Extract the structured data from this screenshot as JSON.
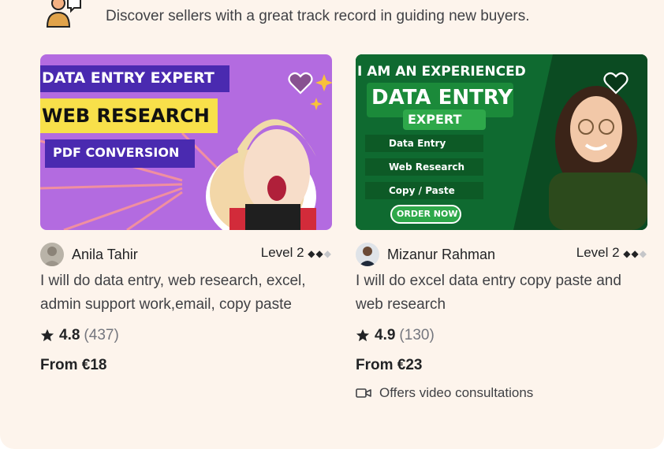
{
  "header": {
    "subtitle": "Discover sellers with a great track record in guiding new buyers."
  },
  "gigs": [
    {
      "image_text": {
        "line1": "DATA ENTRY EXPERT",
        "line2": "WEB RESEARCH",
        "line3": "PDF CONVERSION"
      },
      "seller_name": "Anila Tahir",
      "level_label": "Level 2",
      "level_diamonds_filled": "◆◆",
      "level_diamonds_empty": "◆",
      "title": "I will do data entry, web research, excel, admin support work,email, copy paste",
      "rating": "4.8",
      "reviews": "(437)",
      "price": "From €18"
    },
    {
      "image_text": {
        "line1": "I AM AN EXPERIENCED",
        "line2": "DATA ENTRY",
        "line3": "EXPERT",
        "bullets": [
          "Data Entry",
          "Web Research",
          "Copy / Paste"
        ],
        "cta": "ORDER NOW"
      },
      "seller_name": "Mizanur Rahman",
      "level_label": "Level 2",
      "level_diamonds_filled": "◆◆",
      "level_diamonds_empty": "◆",
      "title": "I will do excel data entry copy paste and web research",
      "rating": "4.9",
      "reviews": "(130)",
      "price": "From €23",
      "video_note": "Offers video consultations"
    }
  ],
  "colors": {
    "background": "#fdf4ec",
    "card1_bg": "#b36be0",
    "card2_bg": "#0e5a2a",
    "heart": "#ffffff"
  },
  "icons": [
    "person-icon",
    "heart-icon",
    "star-icon",
    "video-icon"
  ]
}
